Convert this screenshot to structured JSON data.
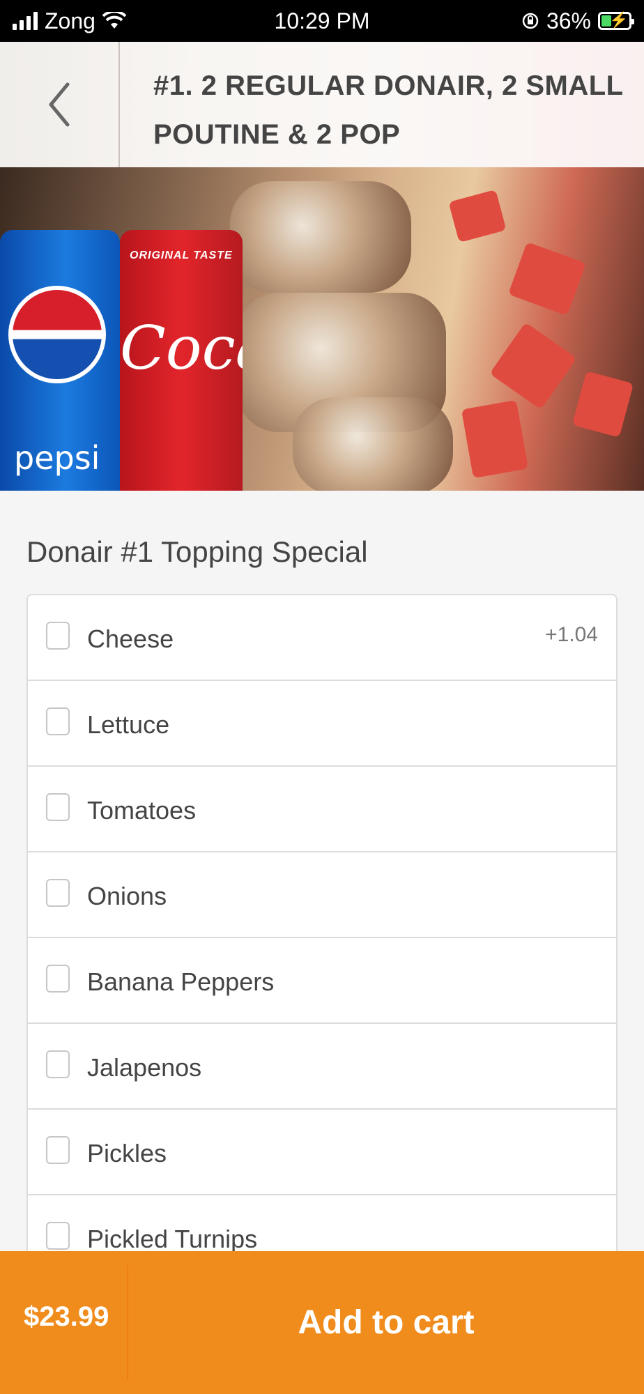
{
  "status_bar": {
    "carrier": "Zong",
    "time": "10:29 PM",
    "battery_percent": "36%",
    "battery_level": 0.36,
    "icons": [
      "signal-icon",
      "wifi-icon",
      "orientation-lock-icon",
      "battery-icon"
    ]
  },
  "header": {
    "back_icon": "chevron-left-icon",
    "title": "#1. 2 REGULAR DONAIR, 2 SMALL POUTINE & 2 POP"
  },
  "hero": {
    "pepsi_text": "pepsi",
    "coke_top_text": "ORIGINAL TASTE",
    "coke_script": "Coca-Co"
  },
  "section": {
    "title": "Donair #1 Topping Special",
    "options": [
      {
        "label": "Cheese",
        "price": "+1.04"
      },
      {
        "label": "Lettuce",
        "price": ""
      },
      {
        "label": "Tomatoes",
        "price": ""
      },
      {
        "label": "Onions",
        "price": ""
      },
      {
        "label": "Banana Peppers",
        "price": ""
      },
      {
        "label": "Jalapenos",
        "price": ""
      },
      {
        "label": "Pickles",
        "price": ""
      },
      {
        "label": "Pickled Turnips",
        "price": ""
      }
    ]
  },
  "footer": {
    "price": "$23.99",
    "add_to_cart": "Add to cart"
  },
  "colors": {
    "accent": "#f08c1c",
    "text": "#444444",
    "border": "#dcdcdc"
  }
}
